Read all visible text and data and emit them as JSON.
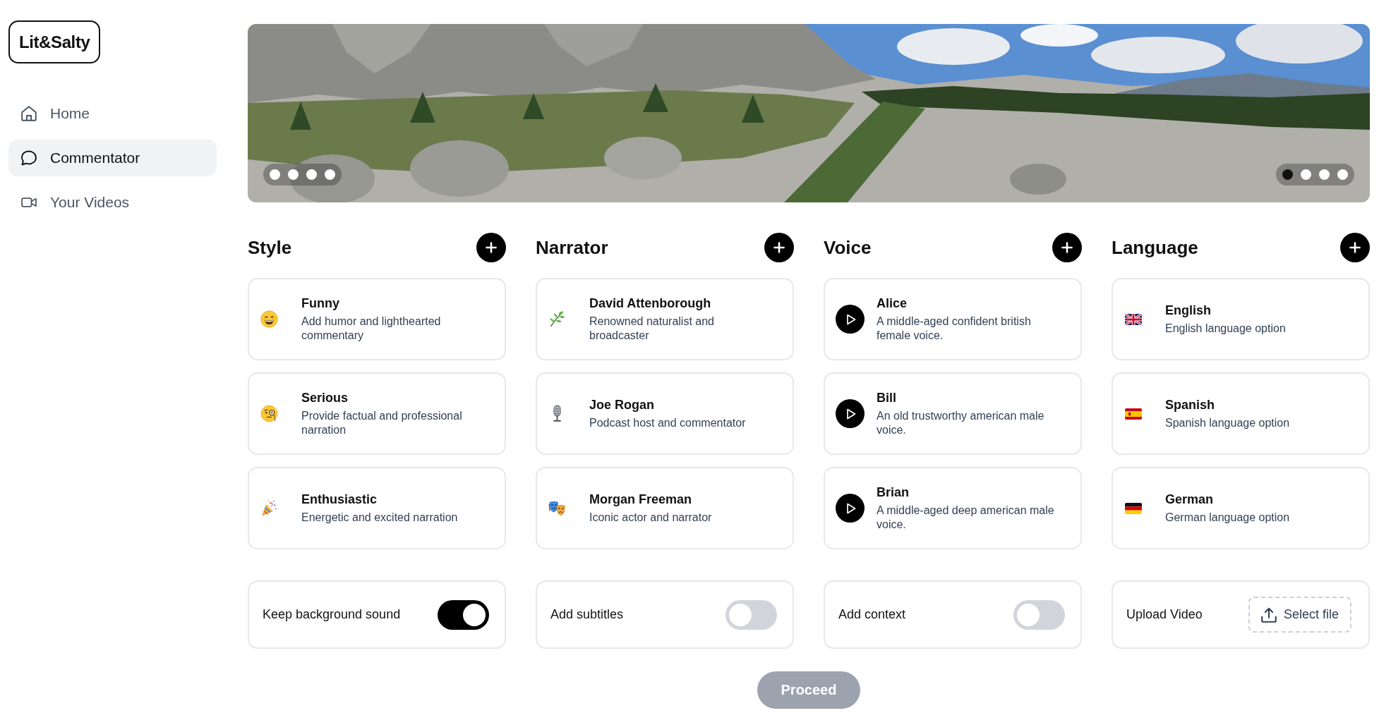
{
  "sidebar": {
    "logo": "Lit&Salty",
    "items": [
      {
        "label": "Home",
        "selected": false
      },
      {
        "label": "Commentator",
        "selected": true
      },
      {
        "label": "Your Videos",
        "selected": false
      }
    ]
  },
  "banner": {
    "dots_left": [
      {
        "selected": false
      },
      {
        "selected": false
      },
      {
        "selected": false
      },
      {
        "selected": false
      }
    ],
    "dots_right": [
      {
        "selected": true
      },
      {
        "selected": false
      },
      {
        "selected": false
      },
      {
        "selected": false
      }
    ]
  },
  "sections": [
    {
      "title": "Style",
      "kind": "emoji",
      "options": [
        {
          "title": "Funny",
          "description": "Add humor and lighthearted commentary"
        },
        {
          "title": "Serious",
          "description": "Provide factual and professional narration"
        },
        {
          "title": "Enthusiastic",
          "description": "Energetic and excited narration"
        }
      ]
    },
    {
      "title": "Narrator",
      "kind": "emoji",
      "options": [
        {
          "title": "David Attenborough",
          "description": "Renowned naturalist and broadcaster"
        },
        {
          "title": "Joe Rogan",
          "description": "Podcast host and commentator"
        },
        {
          "title": "Morgan Freeman",
          "description": "Iconic actor and narrator"
        }
      ]
    },
    {
      "title": "Voice",
      "kind": "voice",
      "options": [
        {
          "title": "Alice",
          "description": "A middle-aged confident british female voice."
        },
        {
          "title": "Bill",
          "description": "An old trustworthy american male voice."
        },
        {
          "title": "Brian",
          "description": "A middle-aged deep american male voice."
        }
      ]
    },
    {
      "title": "Language",
      "kind": "emoji",
      "options": [
        {
          "title": "English",
          "description": "English language option"
        },
        {
          "title": "Spanish",
          "description": "Spanish language option"
        },
        {
          "title": "German",
          "description": "German language option"
        }
      ]
    }
  ],
  "settings": [
    {
      "kind": "toggle",
      "label": "Keep background sound",
      "on": true
    },
    {
      "kind": "toggle",
      "label": "Add subtitles",
      "on": false
    },
    {
      "kind": "toggle",
      "label": "Add context",
      "on": false
    },
    {
      "kind": "upload",
      "label": "Upload Video",
      "button": "Select file"
    }
  ],
  "proceed": {
    "label": "Proceed",
    "disabled": true
  }
}
